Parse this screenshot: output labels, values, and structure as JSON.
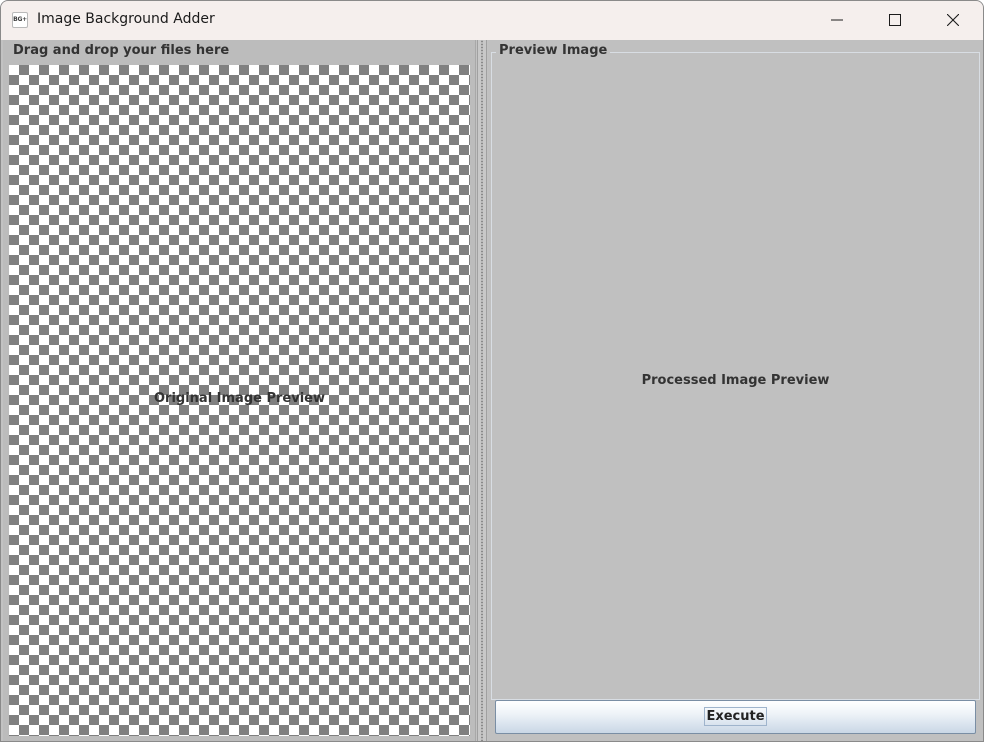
{
  "window": {
    "title": "Image Background Adder",
    "icon_text": "BG+",
    "controls": [
      "minimize-icon",
      "maximize-icon",
      "close-icon"
    ]
  },
  "left_panel": {
    "title": "Drag and drop your files here",
    "preview_label": "Original Image Preview",
    "background": "checkerboard",
    "checker_colors": [
      "#ffffff",
      "#808080"
    ]
  },
  "right_panel": {
    "title": "Preview Image",
    "preview_label": "Processed Image Preview",
    "background_color": "#c0c0c0"
  },
  "actions": {
    "execute_label": "Execute"
  }
}
